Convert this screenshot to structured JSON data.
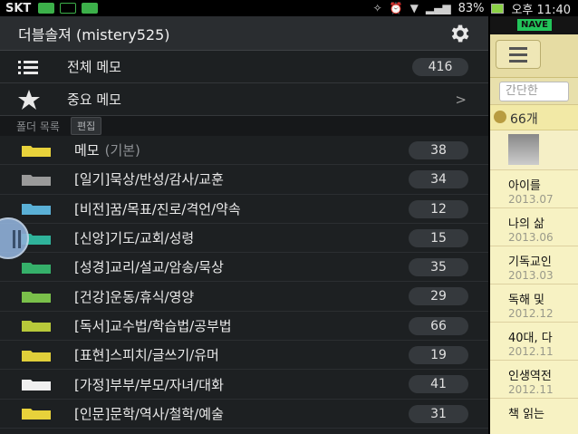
{
  "status_bar": {
    "carrier": "SKT",
    "battery": "83%",
    "time": "오후 11:40",
    "colors": {
      "bar": "#000000",
      "icon_green": "#3cb04a"
    }
  },
  "background_app": {
    "logo": "NAVE",
    "search_placeholder": "간단한",
    "count_text": "66개",
    "entries": [
      {
        "title": "아이를",
        "date": "2013.07"
      },
      {
        "title": "나의 삶",
        "date": "2013.06"
      },
      {
        "title": "기독교인",
        "date": "2013.03"
      },
      {
        "title": "독해 및",
        "date": "2012.12"
      },
      {
        "title": "40대, 다",
        "date": "2012.11"
      },
      {
        "title": "인생역전",
        "date": "2012.11"
      },
      {
        "title": "책 읽는",
        "date": ""
      }
    ]
  },
  "drawer": {
    "account_title": "더블솔져 (mistery525)",
    "all_memos": {
      "label": "전체 메모",
      "count": "416",
      "icon": "list-icon"
    },
    "starred": {
      "label": "중요 메모",
      "icon": "star-icon"
    },
    "folder_section": {
      "label": "폴더 목록",
      "edit_label": "편집"
    },
    "folders": [
      {
        "name": "메모",
        "sub": "(기본)",
        "count": "38",
        "color": "#e8d23b"
      },
      {
        "name": "[일기]묵상/반성/감사/교훈",
        "sub": "",
        "count": "34",
        "color": "#9a9a9a"
      },
      {
        "name": "[비전]꿈/목표/진로/격언/약속",
        "sub": "",
        "count": "12",
        "color": "#5ab0d6"
      },
      {
        "name": "[신앙]기도/교회/성령",
        "sub": "",
        "count": "15",
        "color": "#2fb39b"
      },
      {
        "name": "[성경]교리/설교/암송/묵상",
        "sub": "",
        "count": "35",
        "color": "#35b06a"
      },
      {
        "name": "[건강]운동/휴식/영양",
        "sub": "",
        "count": "29",
        "color": "#7ac04a"
      },
      {
        "name": "[독서]교수법/학습법/공부법",
        "sub": "",
        "count": "66",
        "color": "#b8c93a"
      },
      {
        "name": "[표현]스피치/글쓰기/유머",
        "sub": "",
        "count": "19",
        "color": "#e0cf3a"
      },
      {
        "name": "[가정]부부/부모/자녀/대화",
        "sub": "",
        "count": "41",
        "color": "#f0f0f0"
      },
      {
        "name": "[인문]문학/역사/철학/예술",
        "sub": "",
        "count": "31",
        "color": "#e8d23b"
      }
    ]
  }
}
